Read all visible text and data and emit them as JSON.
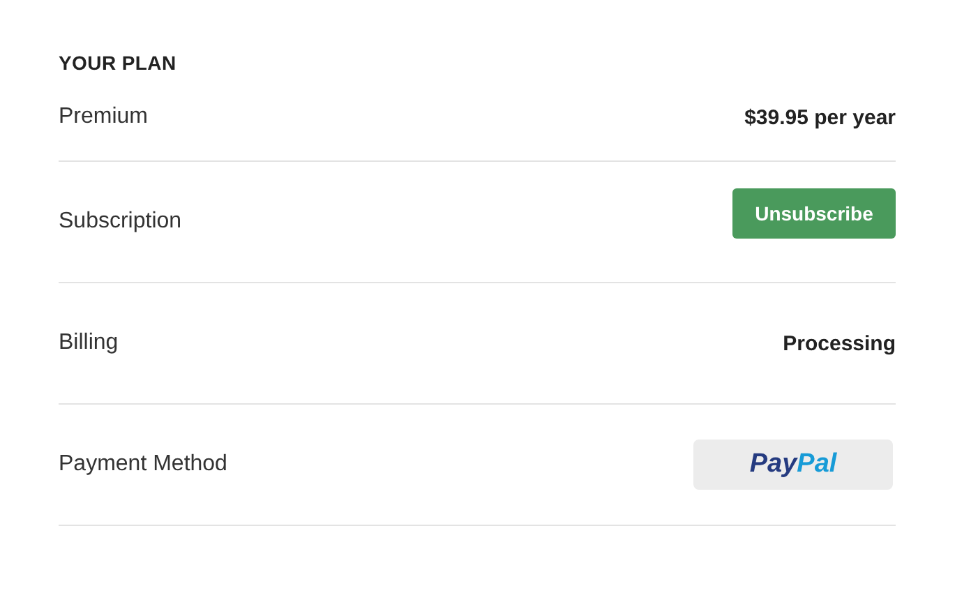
{
  "heading": "YOUR PLAN",
  "rows": [
    {
      "label": "Premium",
      "kind": "text",
      "value": "$39.95 per year"
    },
    {
      "label": "Subscription",
      "kind": "button",
      "value": "Unsubscribe"
    },
    {
      "label": "Billing",
      "kind": "text",
      "value": "Processing"
    },
    {
      "label": "Payment Method",
      "kind": "logo",
      "value_parts": [
        "Pay",
        "Pal"
      ]
    }
  ]
}
